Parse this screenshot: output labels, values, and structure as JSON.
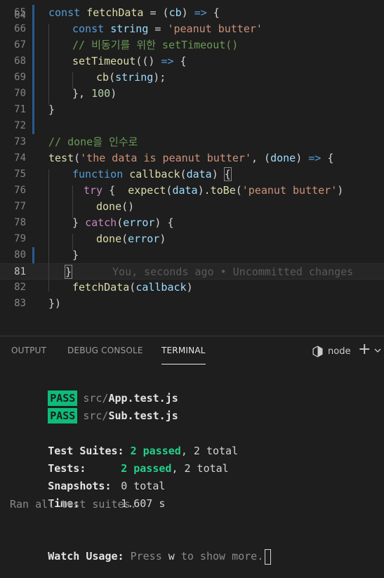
{
  "editor": {
    "first_line": "64",
    "lines": [
      {
        "num": "65",
        "t": [
          [
            "kw",
            "const "
          ],
          [
            "fn",
            "fetchData"
          ],
          [
            "pl",
            " = ("
          ],
          [
            "var",
            "cb"
          ],
          [
            "pl",
            ") "
          ],
          [
            "kw",
            "=>"
          ],
          [
            "pl",
            " {"
          ]
        ]
      },
      {
        "num": "66",
        "t": [
          [
            "kw",
            "const "
          ],
          [
            "var",
            "string"
          ],
          [
            "pl",
            " = "
          ],
          [
            "str",
            "'peanut butter'"
          ]
        ]
      },
      {
        "num": "67",
        "t": [
          [
            "cm",
            "// 비동기를 위한 setTimeout()"
          ]
        ]
      },
      {
        "num": "68",
        "t": [
          [
            "fn",
            "setTimeout"
          ],
          [
            "pl",
            "(() "
          ],
          [
            "kw",
            "=>"
          ],
          [
            "pl",
            " {"
          ]
        ]
      },
      {
        "num": "69",
        "t": [
          [
            "fn",
            "cb"
          ],
          [
            "pl",
            "("
          ],
          [
            "var",
            "string"
          ],
          [
            "pl",
            ");"
          ]
        ]
      },
      {
        "num": "70",
        "t": [
          [
            "pl",
            "}, "
          ],
          [
            "num",
            "100"
          ],
          [
            "pl",
            ")"
          ]
        ]
      },
      {
        "num": "71",
        "t": [
          [
            "pl",
            "}"
          ]
        ]
      },
      {
        "num": "72",
        "t": []
      },
      {
        "num": "73",
        "t": [
          [
            "cm",
            "// done을 인수로"
          ]
        ]
      },
      {
        "num": "74",
        "t": [
          [
            "fn",
            "test"
          ],
          [
            "pl",
            "("
          ],
          [
            "str",
            "'the data is peanut butter'"
          ],
          [
            "pl",
            ", ("
          ],
          [
            "var",
            "done"
          ],
          [
            "pl",
            ") "
          ],
          [
            "kw",
            "=>"
          ],
          [
            "pl",
            " {"
          ]
        ]
      },
      {
        "num": "75",
        "t": [
          [
            "kw",
            "function "
          ],
          [
            "fn",
            "callback"
          ],
          [
            "pl",
            "("
          ],
          [
            "var",
            "data"
          ],
          [
            "pl",
            ") "
          ],
          [
            "brk",
            "{"
          ]
        ]
      },
      {
        "num": "76",
        "t": [
          [
            "ctl",
            "try"
          ],
          [
            "pl",
            " {  "
          ],
          [
            "fn",
            "expect"
          ],
          [
            "pl",
            "("
          ],
          [
            "var",
            "data"
          ],
          [
            "pl",
            ")."
          ],
          [
            "fn",
            "toBe"
          ],
          [
            "pl",
            "("
          ],
          [
            "str",
            "'peanut butter'"
          ],
          [
            "pl",
            ")"
          ]
        ]
      },
      {
        "num": "77",
        "t": [
          [
            "fn",
            "done"
          ],
          [
            "pl",
            "()"
          ]
        ]
      },
      {
        "num": "78",
        "t": [
          [
            "pl",
            "} "
          ],
          [
            "ctl",
            "catch"
          ],
          [
            "pl",
            "("
          ],
          [
            "var",
            "error"
          ],
          [
            "pl",
            ") {"
          ]
        ]
      },
      {
        "num": "79",
        "t": [
          [
            "fn",
            "done"
          ],
          [
            "pl",
            "("
          ],
          [
            "var",
            "error"
          ],
          [
            "pl",
            ")"
          ]
        ]
      },
      {
        "num": "80",
        "t": [
          [
            "pl",
            "}"
          ]
        ]
      },
      {
        "num": "81",
        "t": [
          [
            "brk",
            "}"
          ]
        ],
        "blame": "You, seconds ago • Uncommitted changes"
      },
      {
        "num": "82",
        "t": [
          [
            "fn",
            "fetchData"
          ],
          [
            "pl",
            "("
          ],
          [
            "var",
            "callback"
          ],
          [
            "pl",
            ")"
          ]
        ]
      },
      {
        "num": "83",
        "t": [
          [
            "pl",
            "})"
          ]
        ]
      }
    ]
  },
  "panel": {
    "tabs": [
      "OUTPUT",
      "DEBUG CONSOLE",
      "TERMINAL"
    ],
    "active_tab": "TERMINAL",
    "shell_label": "node",
    "icons": {
      "shell": "cube-icon",
      "add": "plus-icon",
      "dropdown": "chevron-down-icon"
    }
  },
  "terminal": {
    "results": [
      {
        "badge": "PASS",
        "dir": "src/",
        "file": "App.test.js"
      },
      {
        "badge": "PASS",
        "dir": "src/",
        "file": "Sub.test.js"
      }
    ],
    "suites_label": "Test Suites:",
    "suites_passed": "2 passed",
    "suites_total": ", 2 total",
    "tests_label": "Tests:",
    "tests_passed": "2 passed",
    "tests_total": ", 2 total",
    "snapshots_label": "Snapshots:",
    "snapshots_value": "0 total",
    "time_label": "Time:",
    "time_value": "1.607 s",
    "ran_all": "Ran all test suites.",
    "watch_label": "Watch Usage:",
    "watch_press": " Press ",
    "watch_key": "w",
    "watch_rest": " to show more."
  },
  "colors": {
    "pass_badge": "#0dbc79",
    "passed_text": "#23d18b",
    "background": "#1e1e1e"
  }
}
